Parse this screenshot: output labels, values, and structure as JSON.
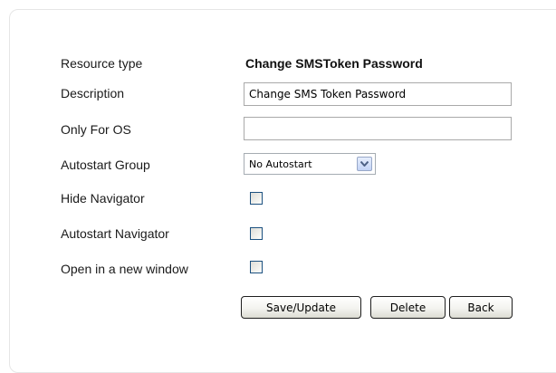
{
  "form": {
    "resource_type_label": "Resource type",
    "resource_type_value": "Change SMSToken Password",
    "description_label": "Description",
    "description_value": "Change SMS Token Password",
    "only_for_os_label": "Only For OS",
    "only_for_os_value": "",
    "autostart_group_label": "Autostart Group",
    "autostart_group_value": "No Autostart",
    "hide_navigator_label": "Hide Navigator",
    "hide_navigator_checked": false,
    "autostart_navigator_label": "Autostart Navigator",
    "autostart_navigator_checked": false,
    "open_new_window_label": "Open in a new window",
    "open_new_window_checked": false
  },
  "buttons": {
    "save_label": "Save/Update",
    "delete_label": "Delete",
    "back_label": "Back"
  },
  "icons": {
    "dropdown": "chevron-down-icon"
  },
  "colors": {
    "checkbox_border": "#1c5180",
    "arrow_color": "#4d6185"
  }
}
